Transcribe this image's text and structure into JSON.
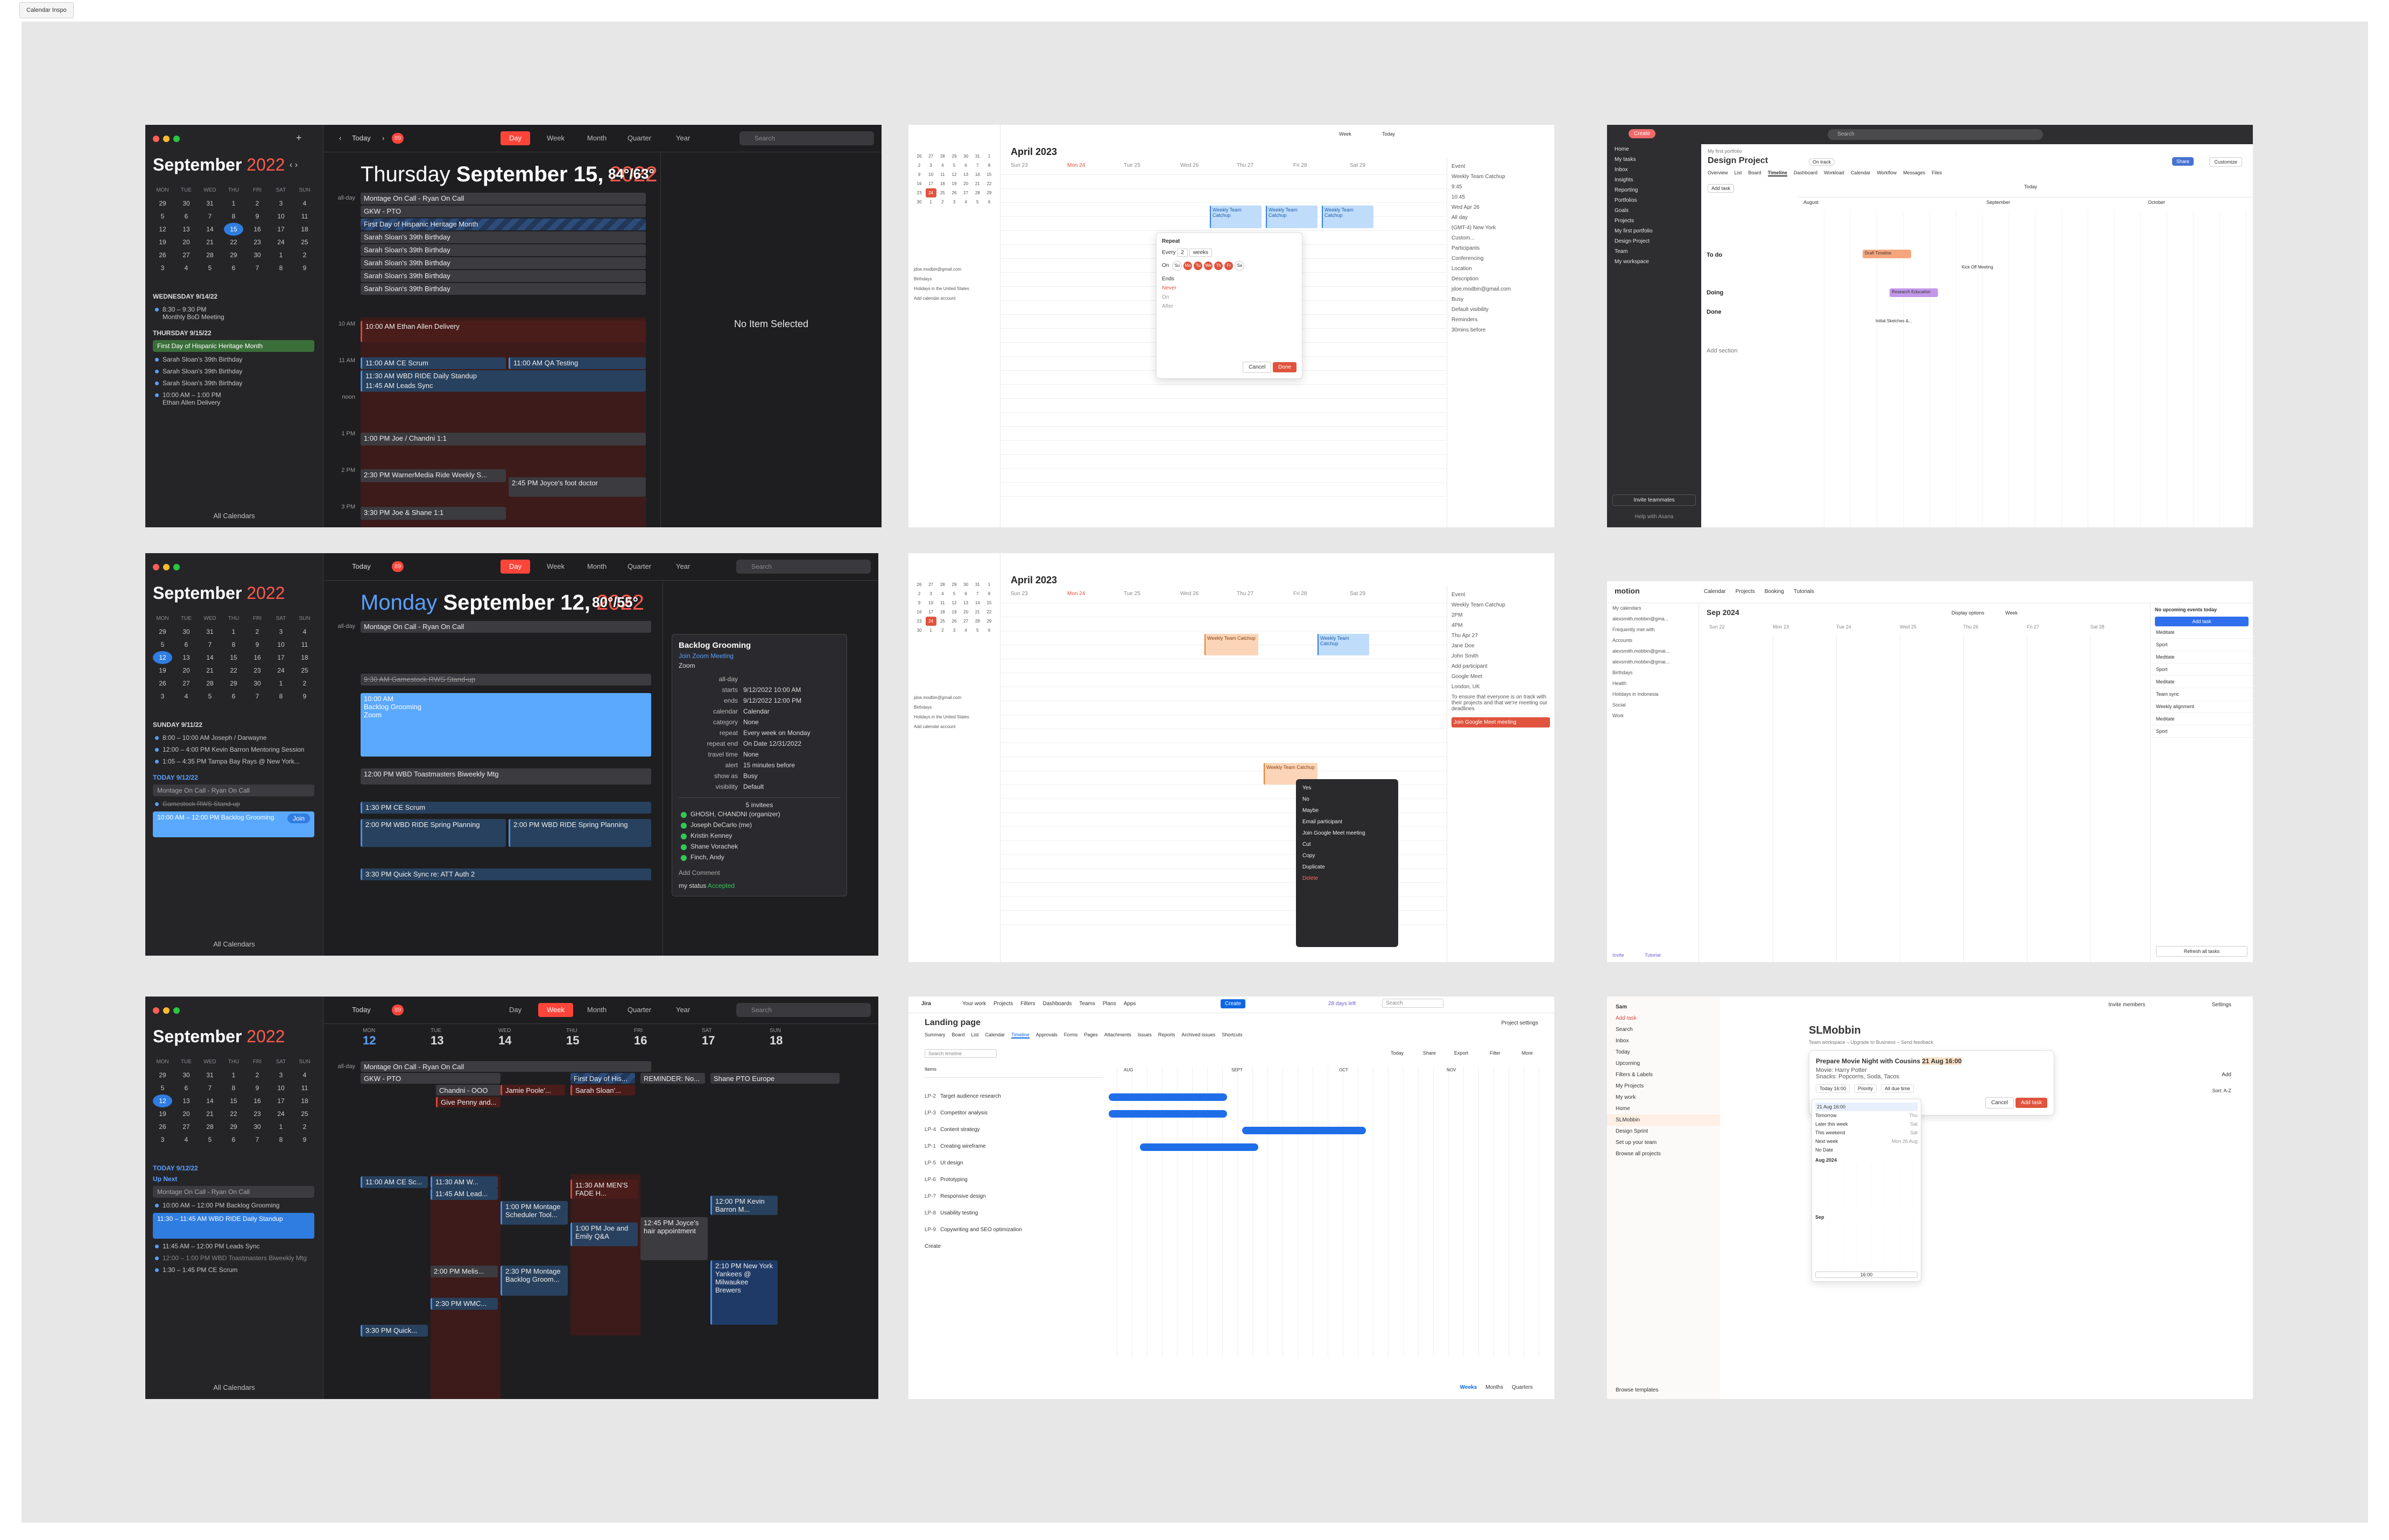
{
  "canvas_label": "Calendar Inspo",
  "colors": {
    "accent_red": "#ff453a",
    "dark_bg": "#1e1e20",
    "blue": "#4b8ee8",
    "orange": "#e77c2c"
  },
  "frame1": {
    "month_title": "September",
    "month_year": "2022",
    "dow": [
      "MON",
      "TUE",
      "WED",
      "THU",
      "FRI",
      "SAT",
      "SUN"
    ],
    "weeks": [
      [
        "29",
        "30",
        "31",
        "1",
        "2",
        "3",
        "4"
      ],
      [
        "5",
        "6",
        "7",
        "8",
        "9",
        "10",
        "11"
      ],
      [
        "12",
        "13",
        "14",
        "15",
        "16",
        "17",
        "18"
      ],
      [
        "19",
        "20",
        "21",
        "22",
        "23",
        "24",
        "25"
      ],
      [
        "26",
        "27",
        "28",
        "29",
        "30",
        "1",
        "2"
      ],
      [
        "3",
        "4",
        "5",
        "6",
        "7",
        "8",
        "9"
      ]
    ],
    "agenda": [
      {
        "head": "WEDNESDAY 9/14/22",
        "temp": "84°/63°"
      },
      {
        "item": "8:30 – 9:30 PM",
        "title": "Monthly BoD Meeting"
      },
      {
        "head": "THURSDAY 9/15/22",
        "temp": "84°/63°"
      },
      {
        "item": "First Day of Hispanic Heritage Month"
      },
      {
        "item": "Sarah Sloan's 39th Birthday"
      },
      {
        "item": "10:00 AM – 1:00 PM",
        "title": "Ethan Allen Delivery"
      }
    ],
    "footer": "All Calendars",
    "today_btn": "Today",
    "badge": "89",
    "views": [
      "Day",
      "Week",
      "Month",
      "Quarter",
      "Year"
    ],
    "search_placeholder": "Search",
    "day_label": "Thursday",
    "day_date": "September 15,",
    "day_year": "2022",
    "temp": "84°/63°",
    "allday_label": "all-day",
    "allday_events": [
      "Montage On Call - Ryan On Call",
      "GKW - PTO",
      "First Day of Hispanic Heritage Month",
      "Sarah Sloan's 39th Birthday",
      "Sarah Sloan's 39th Birthday",
      "Sarah Sloan's 39th Birthday",
      "Sarah Sloan's 39th Birthday",
      "Sarah Sloan's 39th Birthday"
    ],
    "hours": [
      "10 AM",
      "11 AM",
      "noon",
      "1 PM",
      "2 PM",
      "3 PM"
    ],
    "events": [
      "10:00 AM Ethan Allen Delivery",
      "11:00 AM CE Scrum",
      "11:30 AM WBD RIDE Daily Standup",
      "11:45 AM Leads Sync",
      "1:00 PM Joe / Chandni 1:1",
      "2:30 PM WarnerMedia Ride Weekly S...",
      "2:45 PM Joyce's foot doctor",
      "3:30 PM Joe & Shane 1:1",
      "11:00 AM QA Testing"
    ],
    "no_item": "No Item Selected"
  },
  "frame2": {
    "day_label": "Monday",
    "day_date": "September 12,",
    "day_year": "2022",
    "temp": "80°/55°",
    "events": [
      "9:30 AM Gamestock RWS Stand-up",
      "10:00 AM",
      "Backlog Grooming",
      "Zoom",
      "12:00 PM WBD Toastmasters Biweekly Mtg",
      "1:30 PM CE Scrum",
      "2:00 PM WBD RIDE Spring Planning",
      "2:00 PM WBD RIDE Spring Planning",
      "3:30 PM Quick Sync re: ATT Auth 2"
    ],
    "agenda": [
      "SUNDAY 9/11/22",
      "8:00 – 10:00 AM Joseph / Darwayne",
      "12:00 – 4:00 PM Kevin Barron Mentoring Session",
      "1:05 – 4:35 PM Tampa Bay Rays @ New York...",
      "TODAY 9/12/22",
      "Montage On Call - Ryan On Call",
      "Gamestock RWS Stand-up",
      "10:00 AM – 12:00 PM Backlog Grooming"
    ],
    "join": "Join",
    "popover": {
      "title": "Backlog Grooming",
      "link": "Join Zoom Meeting",
      "loc": "Zoom",
      "rows": [
        [
          "all-day",
          ""
        ],
        [
          "starts",
          "9/12/2022    10:00 AM"
        ],
        [
          "ends",
          "9/12/2022    12:00 PM"
        ],
        [
          "calendar",
          "Calendar"
        ],
        [
          "category",
          "None"
        ],
        [
          "repeat",
          "Every week on Monday"
        ],
        [
          "repeat end",
          "On Date    12/31/2022"
        ],
        [
          "travel time",
          "None"
        ],
        [
          "alert",
          "15 minutes before"
        ],
        [
          "show as",
          "Busy"
        ],
        [
          "visibility",
          "Default"
        ]
      ],
      "invitees_label": "5 invitees",
      "invitees": [
        "GHOSH, CHANDNI (organizer)",
        "Joseph DeCarlo (me)",
        "Kristin Kenney",
        "Shane Vorachek",
        "Finch, Andy"
      ],
      "add_comment": "Add Comment",
      "status_label": "my status",
      "status": "Accepted"
    }
  },
  "frame3": {
    "week_days": [
      [
        "MON",
        "12"
      ],
      [
        "TUE",
        "13"
      ],
      [
        "WED",
        "14"
      ],
      [
        "THU",
        "15"
      ],
      [
        "FRI",
        "16"
      ],
      [
        "SAT",
        "17"
      ],
      [
        "SUN",
        "18"
      ]
    ],
    "allday": [
      "Montage On Call - Ryan On Call",
      "GKW - PTO",
      "Chandni - OOO",
      "Give Penny and...",
      "Jamie Poole'...",
      "Sarah Sloan'...",
      "First Day of His...",
      "REMINDER: No...",
      "Shane PTO Europe"
    ],
    "events": [
      "11:00 AM CE Sc...",
      "11:30 AM W...",
      "11:45 AM Lead...",
      "2:00 PM Melis...",
      "2:30 PM WMC...",
      "3:30 PM Quick...",
      "11:30 AM MEN'S FADE H...",
      "12:45 PM Joyce's hair appointment",
      "2:10 PM New York Yankees @ Milwaukee Brewers",
      "12:00 PM Kevin Barron M...",
      "1:00 PM Joe and Emily Q&A",
      "2:30 PM Montage Backlog Groom...",
      "1:00 PM Montage Scheduler Tool..."
    ],
    "agenda": [
      "TODAY 9/12/22",
      "Up Next",
      "Montage On Call - Ryan On Call",
      "10:00 AM – 12:00 PM Backlog Grooming",
      "11:30 – 11:45 AM WBD RIDE Daily Standup",
      "11:45 AM – 12:00 PM Leads Sync",
      "12:00 – 1:00 PM WBD Toastmasters Biweekly Mtg",
      "1:30 – 1:45 PM CE Scrum"
    ]
  },
  "frame4": {
    "month": "April 2023",
    "week": "Week",
    "today": "Today",
    "days": [
      "Sun 23",
      "Mon 24",
      "Tue 25",
      "Wed 26",
      "Thu 27",
      "Fri 28",
      "Sat 29"
    ],
    "mini_weeks": [
      [
        "26",
        "27",
        "28",
        "29",
        "30",
        "31",
        "1"
      ],
      [
        "2",
        "3",
        "4",
        "5",
        "6",
        "7",
        "8"
      ],
      [
        "9",
        "10",
        "11",
        "12",
        "13",
        "14",
        "15"
      ],
      [
        "16",
        "17",
        "18",
        "19",
        "20",
        "21",
        "22"
      ],
      [
        "23",
        "24",
        "25",
        "26",
        "27",
        "28",
        "29"
      ],
      [
        "30",
        "1",
        "2",
        "3",
        "4",
        "5",
        "6"
      ]
    ],
    "calendars": [
      "jdoe.modbin@gmail.com",
      "Birthdays",
      "Holidays in the United States",
      "Add calendar account"
    ],
    "event_title": "Weekly Team Catchup",
    "repeat": {
      "title": "Repeat",
      "every": "Every",
      "n": "2",
      "unit": "weeks",
      "on": "On",
      "days": [
        "Su",
        "Mo",
        "Tu",
        "We",
        "Th",
        "Fr",
        "Sa"
      ],
      "ends": "Ends",
      "never": "Never",
      "on_opt": "On",
      "after": "After",
      "cancel": "Cancel",
      "done": "Done"
    },
    "right": [
      "Event",
      "Weekly Team Catchup",
      "9:45",
      "10:45",
      "Wed Apr 26",
      "All day",
      "(GMT-4) New York",
      "Custom...",
      "Participants",
      "Conferencing",
      "Location",
      "Description",
      "jdoe.modbin@gmail.com",
      "Busy",
      "Default visibility",
      "Reminders",
      "30mins before"
    ]
  },
  "frame5": {
    "month": "April 2023",
    "menu": [
      "Yes",
      "No",
      "Maybe",
      "Email participant",
      "Join Google Meet meeting",
      "Cut",
      "Copy",
      "Duplicate",
      "Delete"
    ],
    "join_btn": "Join Google Meet meeting",
    "right": [
      "Event",
      "Weekly Team Catchup",
      "2PM",
      "4PM",
      "Thu Apr 27",
      "Jane Doe",
      "John Smith",
      "Add participant",
      "Google Meet",
      "London, UK",
      "To ensure that everyone is on track with their projects and that we're meeting our deadlines"
    ]
  },
  "frame6": {
    "create": "Create",
    "search": "Search",
    "breadcrumb": "My first portfolio",
    "title": "Design Project",
    "status": "On track",
    "tabs": [
      "Overview",
      "List",
      "Board",
      "Timeline",
      "Dashboard",
      "Workload",
      "Calendar",
      "Workflow",
      "Messages",
      "Files"
    ],
    "side": [
      "Home",
      "My tasks",
      "Inbox",
      "Insights",
      "Reporting",
      "Portfolios",
      "Goals",
      "Projects",
      "My first portfolio",
      "Design Project",
      "Team",
      "My workspace"
    ],
    "invite": "Invite teammates",
    "help": "Help with Asana",
    "months": [
      "August",
      "September",
      "October"
    ],
    "sections": [
      "To do",
      "Doing",
      "Done",
      "Add section"
    ],
    "bars": [
      "Draft Timeline",
      "Kick Off Meeting",
      "Research Education",
      "Initial Sketches &..."
    ],
    "add_task": "Add task",
    "today": "Today",
    "share": "Share",
    "customize": "Customize"
  },
  "frame7": {
    "brand": "motion",
    "tabs": [
      "Calendar",
      "Projects",
      "Booking",
      "Tutorials"
    ],
    "month": "Sep 2024",
    "today": "Today",
    "week": "Week",
    "display": "Display options",
    "days": [
      "Sun 22",
      "Mon 23",
      "Tue 24",
      "Wed 25",
      "Thu 26",
      "Fri 27",
      "Sat 28"
    ],
    "calendars": [
      "My calendars",
      "alexsmith.mobbin@gma...",
      "Frequently met with",
      "Accounts",
      "alexsmith.mobbin@gmai...",
      "alexsmith.mobbin@gmai...",
      "Birthdays",
      "Health",
      "Holidays in Indonesia",
      "Social",
      "Work"
    ],
    "right_title": "No upcoming events today",
    "add_task": "Add task",
    "right_tasks": [
      "Meditate",
      "Sport",
      "Meditate",
      "Sport",
      "Meditate",
      "Team sync",
      "Weekly alignment",
      "Meditate",
      "Sport"
    ],
    "refresh": "Refresh all tasks",
    "invite": "Invite",
    "tutorial": "Tutorial"
  },
  "frame8": {
    "brand": "Jira",
    "nav": [
      "Your work",
      "Projects",
      "Filters",
      "Dashboards",
      "Teams",
      "Plans",
      "Apps"
    ],
    "create": "Create",
    "trial": "28 days left",
    "search": "Search",
    "title": "Landing page",
    "tabs": [
      "Summary",
      "Board",
      "List",
      "Calendar",
      "Timeline",
      "Approvals",
      "Forms",
      "Pages",
      "Attachments",
      "Issues",
      "Reports",
      "Archived issues",
      "Shortcuts"
    ],
    "project_settings": "Project settings",
    "search_timeline": "Search timeline",
    "today": "Today",
    "share": "Share",
    "export": "Export",
    "filter": "Filter",
    "more": "More",
    "col_items": "Items",
    "months": [
      "AUG",
      "SEPT",
      "OCT",
      "NOV"
    ],
    "rows": [
      [
        "LP-2",
        "Target audience research"
      ],
      [
        "LP-3",
        "Competitor analysis"
      ],
      [
        "LP-4",
        "Content strategy"
      ],
      [
        "LP-1",
        "Creating wireframe"
      ],
      [
        "LP-5",
        "UI design"
      ],
      [
        "LP-6",
        "Prototyping"
      ],
      [
        "LP-7",
        "Responsive design"
      ],
      [
        "LP-8",
        "Usability testing"
      ],
      [
        "LP-9",
        "Copywriting and SEO optimization"
      ]
    ],
    "create_row": "Create",
    "scales": [
      "Weeks",
      "Months",
      "Quarters"
    ]
  },
  "frame9": {
    "user": "Sam",
    "add_task": "Add task",
    "side": [
      "Search",
      "Inbox",
      "Today",
      "Upcoming",
      "Filters & Labels",
      "My Projects",
      "My work",
      "Home",
      "SLMobbin",
      "Design Sprint",
      "Set up your team",
      "Browse all projects"
    ],
    "browse": "Browse templates",
    "invite": "Invite members",
    "settings": "Settings",
    "project": "SLMobbin",
    "workspace": "Team workspace – Upgrade to Business – Send feedback",
    "task": "Prepare Movie Night with Cousins",
    "due": "21 Aug 16:00",
    "desc": "Movie: Harry Potter",
    "desc2": "Snacks: Popcorns, Soda, Tacos",
    "chips": [
      "Today 16:00",
      "Priority",
      "All due time"
    ],
    "cancel": "Cancel",
    "add": "Add task",
    "add_btn": "Add",
    "sort": "Sort: A-Z",
    "date_field": "21 Aug 16:00",
    "quick": [
      [
        "Tomorrow",
        "Thu"
      ],
      [
        "Later this week",
        "Sat"
      ],
      [
        "This weekend",
        "Sat"
      ],
      [
        "Next week",
        "Mon 26 Aug"
      ],
      [
        "No Date",
        ""
      ]
    ],
    "cal_month": "Aug 2024",
    "cal_month2": "Sep",
    "time": "16:00"
  }
}
